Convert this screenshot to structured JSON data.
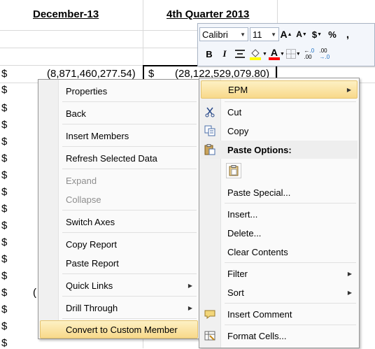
{
  "sheet": {
    "col1_header": "December-13",
    "col2_header": "4th Quarter 2013",
    "currency": "$",
    "row1_value1": "(8,871,460,277.54)",
    "row1_value2": "(28,122,529,079.80)",
    "partial_paren": "("
  },
  "mini_toolbar": {
    "font_name": "Calibri",
    "font_size": "11",
    "grow_font": "A",
    "shrink_font": "A",
    "currency": "$",
    "percent": "%",
    "comma": ",",
    "bold": "B",
    "italic": "I",
    "font_color": "A",
    "increase_decimal": ".0→.00",
    "decrease_decimal": ".00→.0",
    "highlight_color": "#ffff00",
    "font_color_value": "#ff0000"
  },
  "left_menu": {
    "items": [
      {
        "label": "Properties"
      },
      {
        "label": "Back"
      },
      {
        "label": "Insert Members"
      },
      {
        "label": "Refresh Selected Data"
      },
      {
        "label": "Expand"
      },
      {
        "label": "Collapse"
      },
      {
        "label": "Switch Axes"
      },
      {
        "label": "Copy Report"
      },
      {
        "label": "Paste Report"
      },
      {
        "label": "Quick Links"
      },
      {
        "label": "Drill Through"
      },
      {
        "label": "Convert to Custom Member"
      }
    ]
  },
  "right_menu": {
    "items": [
      {
        "label": "EPM"
      },
      {
        "label": "Cut"
      },
      {
        "label": "Copy"
      },
      {
        "label": "Paste Options:"
      },
      {
        "label": "Paste Special..."
      },
      {
        "label": "Insert..."
      },
      {
        "label": "Delete..."
      },
      {
        "label": "Clear Contents"
      },
      {
        "label": "Filter"
      },
      {
        "label": "Sort"
      },
      {
        "label": "Insert Comment"
      },
      {
        "label": "Format Cells..."
      }
    ]
  },
  "icons": {
    "cut": "scissors-icon",
    "copy": "copy-icon",
    "paste": "paste-icon",
    "paste_option": "clipboard-icon",
    "comment": "comment-icon",
    "format": "format-cells-icon",
    "submenu": "chevron-right-icon"
  }
}
